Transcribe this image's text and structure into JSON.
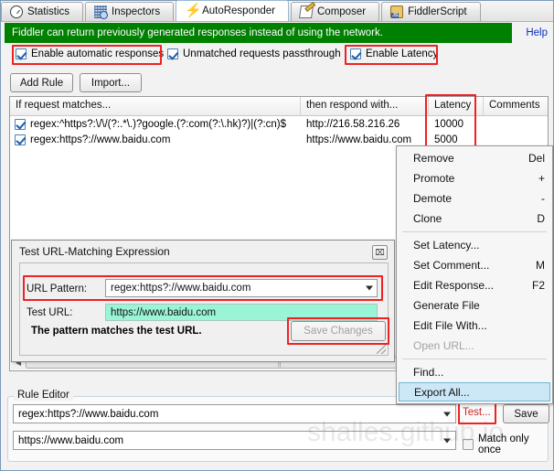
{
  "tabs": [
    {
      "label": "Statistics",
      "icon": "clock-icon",
      "active": false
    },
    {
      "label": "Inspectors",
      "icon": "inspectors-icon",
      "active": false
    },
    {
      "label": "AutoResponder",
      "icon": "lightning-bolt-icon",
      "active": true
    },
    {
      "label": "Composer",
      "icon": "compose-pencil-icon",
      "active": false
    },
    {
      "label": "FiddlerScript",
      "icon": "script-js-icon",
      "active": false
    }
  ],
  "banner": {
    "text": "Fiddler can return previously generated responses instead of using the network.",
    "help_label": "Help",
    "bg_color": "#008000"
  },
  "options": [
    {
      "label": "Enable automatic responses",
      "checked": true,
      "highlighted": true
    },
    {
      "label": "Unmatched requests passthrough",
      "checked": true,
      "highlighted": false
    },
    {
      "label": "Enable Latency",
      "checked": true,
      "highlighted": true
    }
  ],
  "toolbar": {
    "add_rule_label": "Add Rule",
    "import_label": "Import..."
  },
  "rule_list": {
    "columns": [
      "If request matches...",
      "then respond with...",
      "Latency",
      "Comments"
    ],
    "latency_column_highlighted": true,
    "rows": [
      {
        "checked": true,
        "match": "regex:^https?:\\/\\/(?:.*\\.)?google.(?:com(?:\\.hk)?)|(?:cn)$",
        "respond": "http://216.58.216.26",
        "latency": "10000",
        "comments": ""
      },
      {
        "checked": true,
        "match": "regex:https?://www.baidu.com",
        "respond": "https://www.baidu.com",
        "latency": "5000",
        "comments": ""
      }
    ]
  },
  "context_menu": {
    "items": [
      {
        "label": "Remove",
        "accel": "Del",
        "disabled": false,
        "selected": false
      },
      {
        "label": "Promote",
        "accel": "+",
        "disabled": false,
        "selected": false
      },
      {
        "label": "Demote",
        "accel": "-",
        "disabled": false,
        "selected": false
      },
      {
        "label": "Clone",
        "accel": "D",
        "disabled": false,
        "selected": false
      },
      {
        "separator": true
      },
      {
        "label": "Set Latency...",
        "accel": "",
        "disabled": false,
        "selected": false
      },
      {
        "label": "Set Comment...",
        "accel": "M",
        "disabled": false,
        "selected": false
      },
      {
        "label": "Edit Response...",
        "accel": "F2",
        "disabled": false,
        "selected": false
      },
      {
        "label": "Generate File",
        "accel": "",
        "disabled": false,
        "selected": false
      },
      {
        "label": "Edit File With...",
        "accel": "",
        "disabled": false,
        "selected": false
      },
      {
        "label": "Open URL...",
        "accel": "",
        "disabled": true,
        "selected": false
      },
      {
        "separator": true
      },
      {
        "label": "Find...",
        "accel": "",
        "disabled": false,
        "selected": false
      },
      {
        "label": "Export All...",
        "accel": "",
        "disabled": false,
        "selected": true
      }
    ],
    "highlight_color": "#cce8f7"
  },
  "test_dialog": {
    "title": "Test URL-Matching Expression",
    "close_glyph": "⌧",
    "url_pattern_label": "URL Pattern:",
    "url_pattern_value": "regex:https?://www.baidu.com",
    "test_url_label": "Test URL:",
    "test_url_value": "https://www.baidu.com",
    "test_url_bg": "#99f5d6",
    "result_message": "The pattern matches the test URL.",
    "save_changes_label": "Save Changes",
    "save_changes_enabled": false
  },
  "rule_editor": {
    "legend": "Rule Editor",
    "match_value": "regex:https?://www.baidu.com",
    "respond_value": "https://www.baidu.com",
    "test_label": "Test...",
    "save_label": "Save",
    "match_only_once_label": "Match only once",
    "match_only_once_checked": false
  },
  "watermark": "shalles.github.io",
  "highlight_color": "#ee2222"
}
